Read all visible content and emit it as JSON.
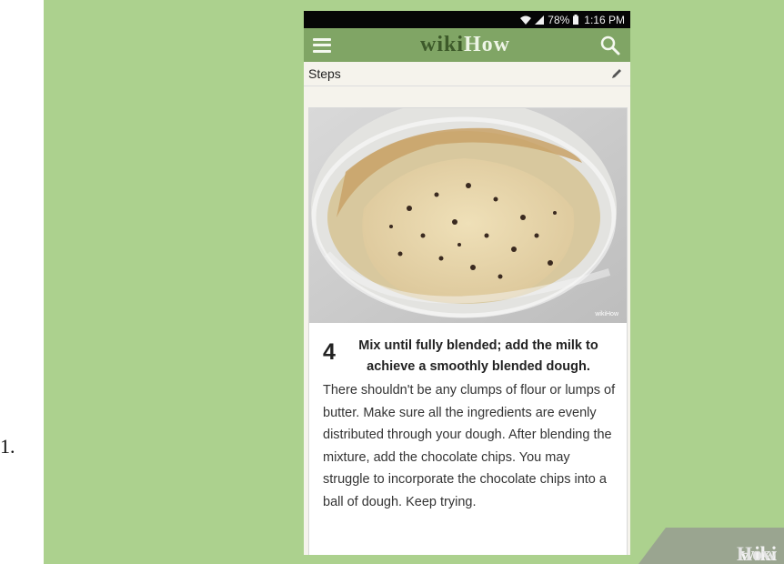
{
  "list_number": "1.",
  "status_bar": {
    "battery": "78%",
    "time": "1:16 PM"
  },
  "header": {
    "logo_wiki": "wiki",
    "logo_how": "How"
  },
  "section": {
    "title": "Steps"
  },
  "step": {
    "number": "4",
    "title": "Mix until fully blended; add the milk to achieve a smoothly blended dough.",
    "description": "There shouldn't be any clumps of flour or lumps of butter. Make sure all the ingredients are evenly distributed through your dough. After blending the mixture, add the chocolate chips. You may struggle to incorporate the chocolate chips into a ball of dough. Keep trying.",
    "image_watermark": "wikiHow"
  },
  "watermark": {
    "wiki": "wiki",
    "how": "How"
  },
  "colors": {
    "background_green": "#acd18e",
    "header_green": "#80a565",
    "status_bar": "#060606"
  }
}
